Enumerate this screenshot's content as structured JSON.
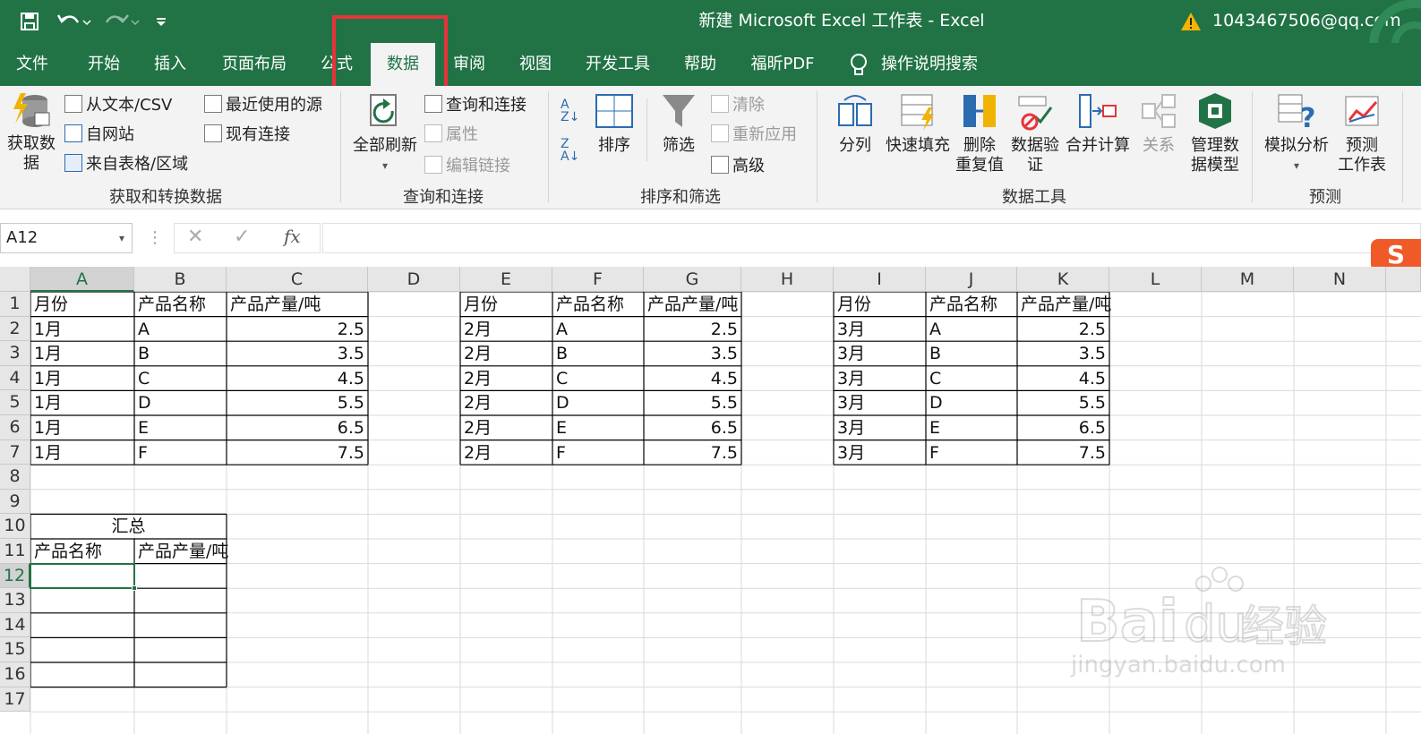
{
  "titlebar": {
    "title": "新建 Microsoft Excel 工作表  -  Excel",
    "account": "1043467506@qq.com",
    "warning_icon": "warning-icon"
  },
  "tabs": [
    "文件",
    "开始",
    "插入",
    "页面布局",
    "公式",
    "数据",
    "审阅",
    "视图",
    "开发工具",
    "帮助",
    "福昕PDF"
  ],
  "active_tab": "数据",
  "tell_me": "操作说明搜索",
  "ribbon": {
    "get_data": "获取数\n据",
    "from_text_csv": "从文本/CSV",
    "from_web": "自网站",
    "from_table": "来自表格/区域",
    "recent_sources": "最近使用的源",
    "existing_connections": "现有连接",
    "group_get_transform": "获取和转换数据",
    "refresh_all": "全部刷新",
    "queries_connections": "查询和连接",
    "properties": "属性",
    "edit_links": "编辑链接",
    "group_queries": "查询和连接",
    "sort": "排序",
    "filter": "筛选",
    "clear": "清除",
    "reapply": "重新应用",
    "advanced": "高级",
    "group_sort_filter": "排序和筛选",
    "text_to_columns": "分列",
    "flash_fill": "快速填充",
    "remove_duplicates": "删除\n重复值",
    "data_validation": "数据验\n证",
    "consolidate": "合并计算",
    "relationships": "关系",
    "manage_data_model": "管理数\n据模型",
    "group_data_tools": "数据工具",
    "what_if": "模拟分析",
    "forecast_sheet": "预测\n工作表",
    "group_forecast": "预测"
  },
  "formula_bar": {
    "name_box": "A12",
    "fx": "fx",
    "value": ""
  },
  "columns": [
    "A",
    "B",
    "C",
    "D",
    "E",
    "F",
    "G",
    "H",
    "I",
    "J",
    "K",
    "L",
    "M",
    "N"
  ],
  "rows": [
    "1",
    "2",
    "3",
    "4",
    "5",
    "6",
    "7",
    "8",
    "9",
    "10",
    "11",
    "12",
    "13",
    "14",
    "15",
    "16",
    "17"
  ],
  "tables": [
    {
      "month_header": "月份",
      "product_header": "产品名称",
      "qty_header": "产品产量/吨",
      "rows": [
        [
          "1月",
          "A",
          "2.5"
        ],
        [
          "1月",
          "B",
          "3.5"
        ],
        [
          "1月",
          "C",
          "4.5"
        ],
        [
          "1月",
          "D",
          "5.5"
        ],
        [
          "1月",
          "E",
          "6.5"
        ],
        [
          "1月",
          "F",
          "7.5"
        ]
      ]
    },
    {
      "month_header": "月份",
      "product_header": "产品名称",
      "qty_header": "产品产量/吨",
      "rows": [
        [
          "2月",
          "A",
          "2.5"
        ],
        [
          "2月",
          "B",
          "3.5"
        ],
        [
          "2月",
          "C",
          "4.5"
        ],
        [
          "2月",
          "D",
          "5.5"
        ],
        [
          "2月",
          "E",
          "6.5"
        ],
        [
          "2月",
          "F",
          "7.5"
        ]
      ]
    },
    {
      "month_header": "月份",
      "product_header": "产品名称",
      "qty_header": "产品产量/吨",
      "rows": [
        [
          "3月",
          "A",
          "2.5"
        ],
        [
          "3月",
          "B",
          "3.5"
        ],
        [
          "3月",
          "C",
          "4.5"
        ],
        [
          "3月",
          "D",
          "5.5"
        ],
        [
          "3月",
          "E",
          "6.5"
        ],
        [
          "3月",
          "F",
          "7.5"
        ]
      ]
    }
  ],
  "summary": {
    "title": "汇总",
    "product_header": "产品名称",
    "qty_header": "产品产量/吨"
  },
  "watermark": {
    "logo": "Bai du 经验",
    "url": "jingyan.baidu.com"
  },
  "colors": {
    "excel_green": "#217346",
    "highlight_red": "#e8333a",
    "selected_header": "#d2d2d2"
  }
}
